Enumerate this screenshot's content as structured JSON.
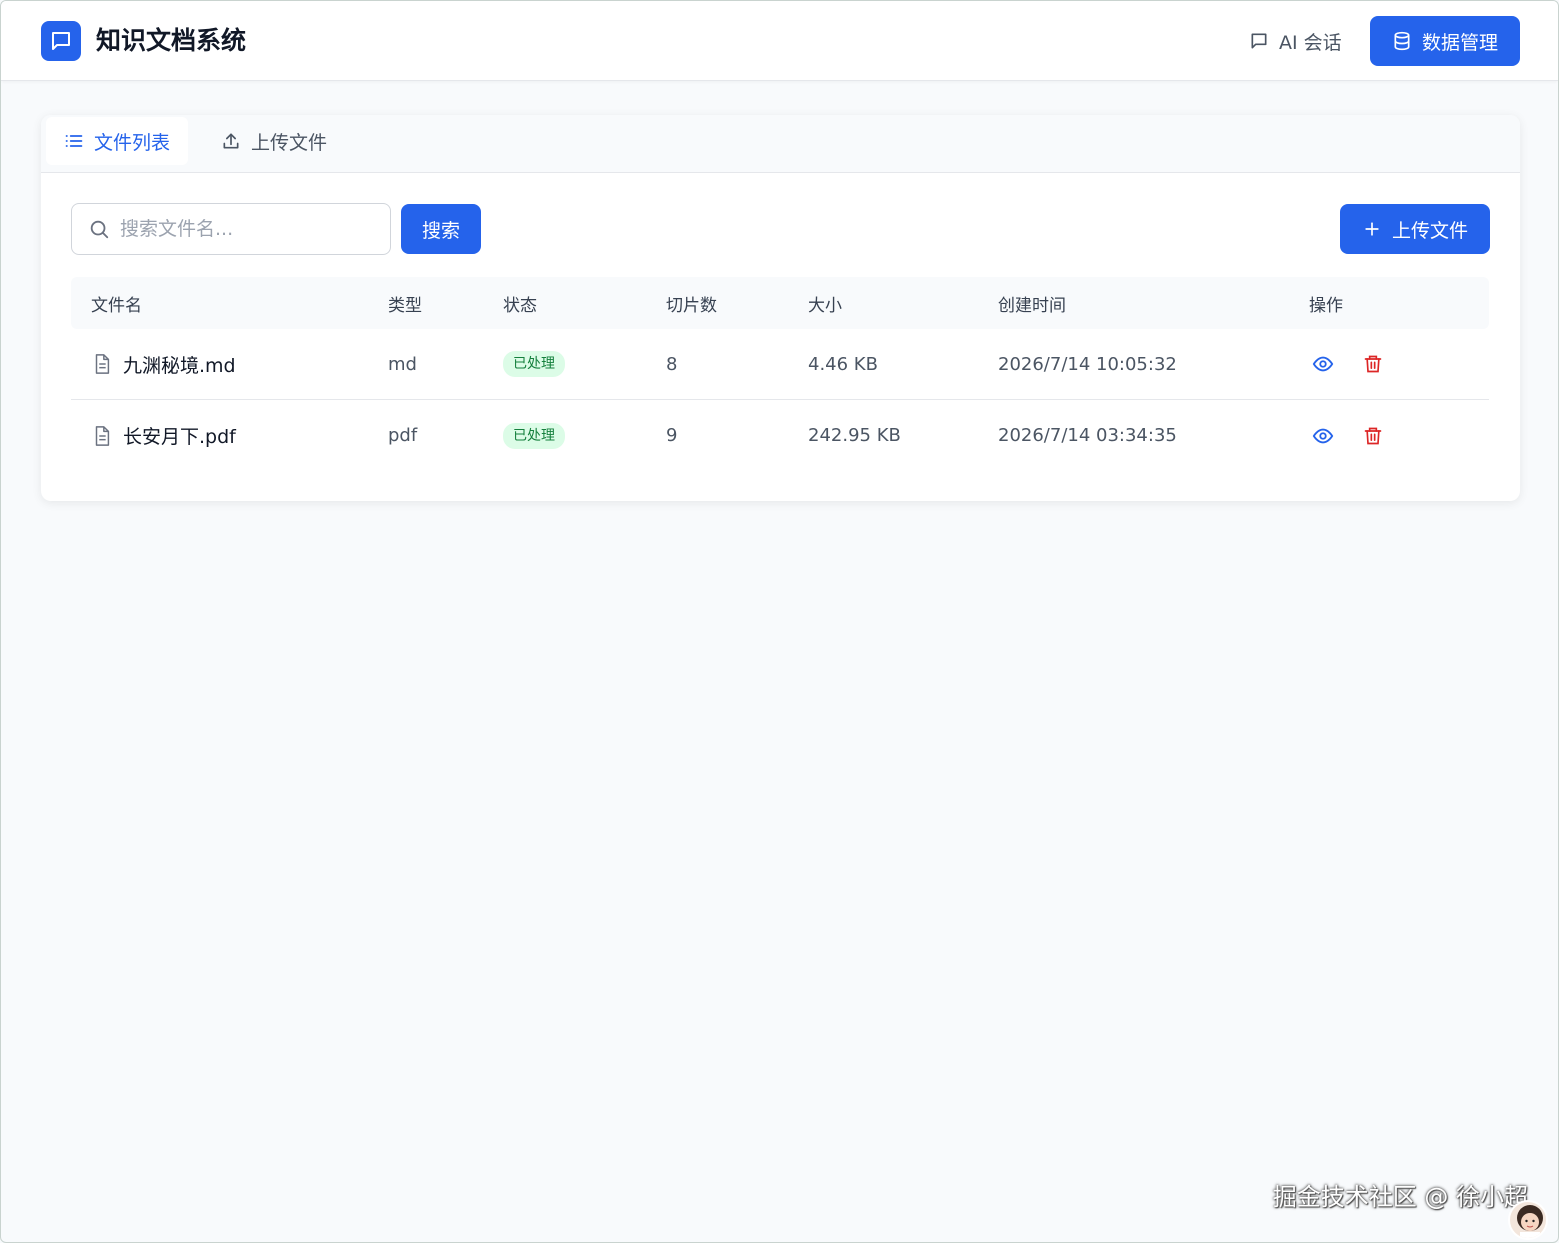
{
  "header": {
    "title": "知识文档系统",
    "nav_chat_label": "AI 会话",
    "nav_data_label": "数据管理",
    "accent_color": "#2563eb"
  },
  "tabs": [
    {
      "label": "文件列表",
      "active": true
    },
    {
      "label": "上传文件",
      "active": false
    }
  ],
  "toolbar": {
    "search_placeholder": "搜索文件名...",
    "search_label": "搜索",
    "upload_label": "上传文件"
  },
  "table": {
    "columns": [
      "文件名",
      "类型",
      "状态",
      "切片数",
      "大小",
      "创建时间",
      "操作"
    ],
    "rows": [
      {
        "name": "九渊秘境.md",
        "type": "md",
        "status": "已处理",
        "chunks": "8",
        "size": "4.46 KB",
        "created": "2026/7/14 10:05:32"
      },
      {
        "name": "长安月下.pdf",
        "type": "pdf",
        "status": "已处理",
        "chunks": "9",
        "size": "242.95 KB",
        "created": "2026/7/14 03:34:35"
      }
    ]
  },
  "watermark": "掘金技术社区 @ 徐小超"
}
